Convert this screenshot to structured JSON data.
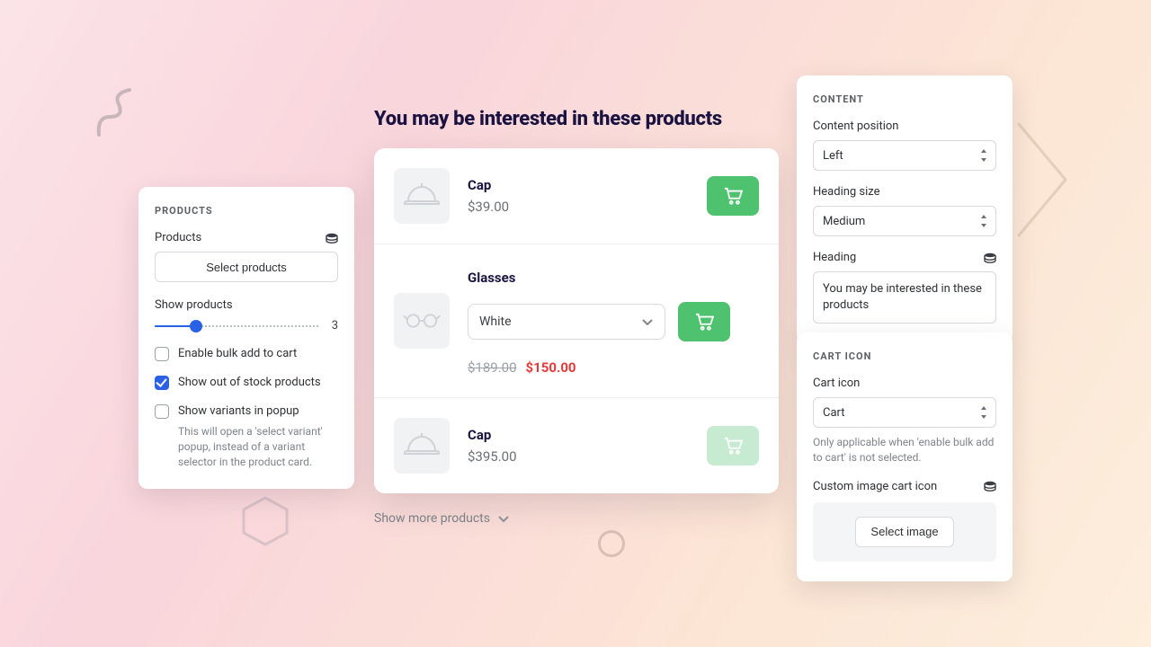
{
  "left_panel": {
    "heading": "PRODUCTS",
    "products_label": "Products",
    "select_products_btn": "Select products",
    "show_products_label": "Show products",
    "show_products_value": "3",
    "enable_bulk_label": "Enable bulk add to cart",
    "show_oos_label": "Show out of stock products",
    "show_variants_label": "Show variants in popup",
    "show_variants_help": "This will open a 'select variant' popup, instead of a variant selector in the product card."
  },
  "preview": {
    "title": "You may be interested in these products",
    "items": [
      {
        "name": "Cap",
        "price": "$39.00"
      },
      {
        "name": "Glasses",
        "variant": "White",
        "price_old": "$189.00",
        "price_new": "$150.00"
      },
      {
        "name": "Cap",
        "price": "$395.00"
      }
    ],
    "show_more": "Show more products"
  },
  "content_panel": {
    "heading": "CONTENT",
    "content_position_label": "Content position",
    "content_position_value": "Left",
    "heading_size_label": "Heading size",
    "heading_size_value": "Medium",
    "heading_label": "Heading",
    "heading_value": "You may be interested in these products"
  },
  "cart_panel": {
    "heading": "CART ICON",
    "cart_icon_label": "Cart icon",
    "cart_icon_value": "Cart",
    "cart_icon_help": "Only applicable when 'enable bulk add to cart' is not selected.",
    "custom_image_label": "Custom image cart icon",
    "select_image_btn": "Select image"
  }
}
